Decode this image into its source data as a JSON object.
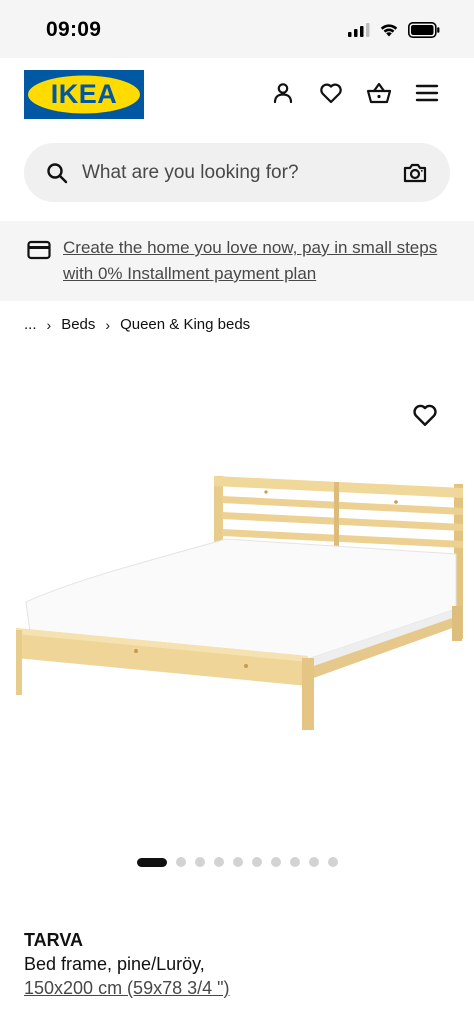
{
  "status_bar": {
    "time": "09:09"
  },
  "header": {
    "logo_text": "IKEA",
    "brand_colors": {
      "blue": "#0058a3",
      "yellow": "#ffdb00"
    },
    "icons": [
      "account-icon",
      "heart-icon",
      "basket-icon",
      "menu-icon"
    ]
  },
  "search": {
    "placeholder": "What are you looking for?",
    "icons": [
      "search-icon",
      "camera-icon"
    ]
  },
  "promo": {
    "text": "Create the home you love now, pay in small steps with 0% Installment payment plan",
    "icon": "credit-card-icon"
  },
  "breadcrumb": {
    "ellipsis": "...",
    "items": [
      "Beds",
      "Queen & King beds"
    ]
  },
  "gallery": {
    "image_description": "bed-frame-photo",
    "current_slide": 1,
    "total_slides": 10
  },
  "product": {
    "name": "TARVA",
    "description": "Bed frame, pine/Luröy,",
    "size": "150x200 cm (59x78 3/4 \")"
  }
}
